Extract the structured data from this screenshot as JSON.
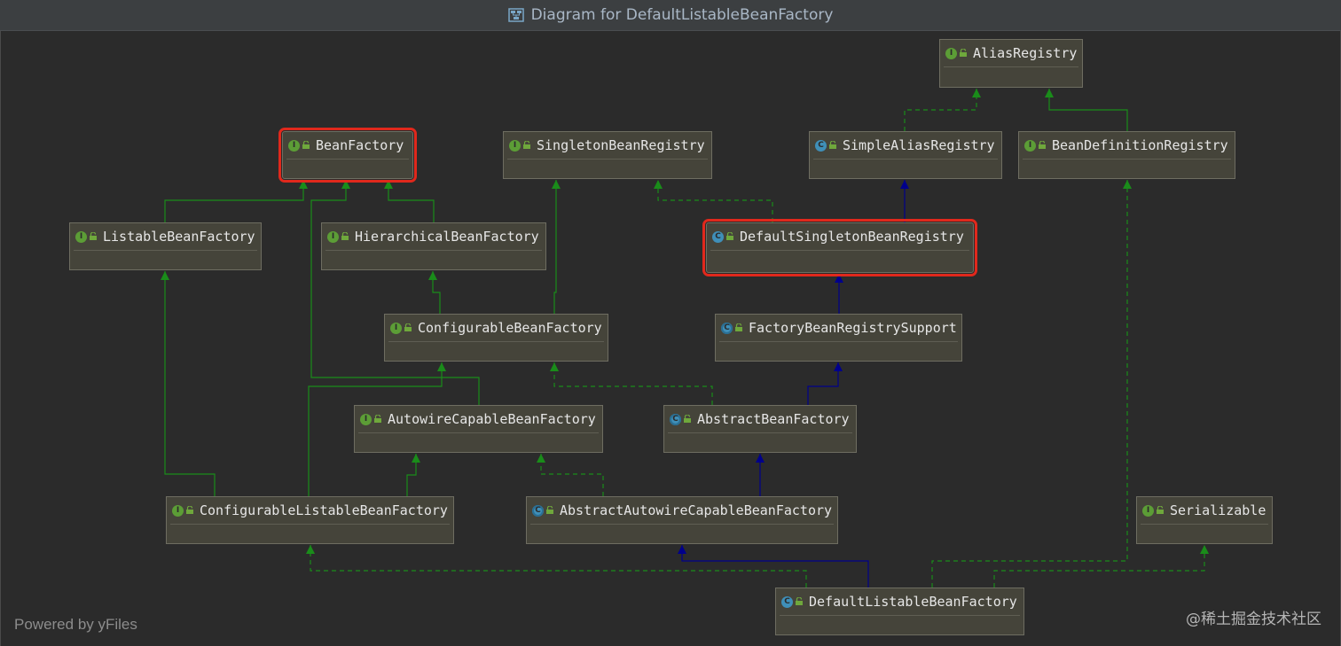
{
  "window": {
    "title": "Diagram for DefaultListableBeanFactory",
    "title_icon": "diagram-icon"
  },
  "colors": {
    "background": "#2b2b2b",
    "node_fill": "#45443a",
    "extends_edge": "#00008b",
    "implements_edge": "#1a8c1a",
    "highlight": "#e0281c",
    "interface_badge": "#5c9d36",
    "class_badge": "#3f8fb8"
  },
  "legend": {
    "interface_badge_letter": "I",
    "class_badge_letter": "C"
  },
  "nodes": [
    {
      "id": "AliasRegistry",
      "label": "AliasRegistry",
      "kind": "interface",
      "highlighted": false
    },
    {
      "id": "BeanFactory",
      "label": "BeanFactory",
      "kind": "interface",
      "highlighted": true
    },
    {
      "id": "SingletonBeanRegistry",
      "label": "SingletonBeanRegistry",
      "kind": "interface",
      "highlighted": false
    },
    {
      "id": "SimpleAliasRegistry",
      "label": "SimpleAliasRegistry",
      "kind": "class",
      "highlighted": false
    },
    {
      "id": "BeanDefinitionRegistry",
      "label": "BeanDefinitionRegistry",
      "kind": "interface",
      "highlighted": false
    },
    {
      "id": "ListableBeanFactory",
      "label": "ListableBeanFactory",
      "kind": "interface",
      "highlighted": false
    },
    {
      "id": "HierarchicalBeanFactory",
      "label": "HierarchicalBeanFactory",
      "kind": "interface",
      "highlighted": false
    },
    {
      "id": "DefaultSingletonBeanRegistry",
      "label": "DefaultSingletonBeanRegistry",
      "kind": "class",
      "highlighted": true
    },
    {
      "id": "ConfigurableBeanFactory",
      "label": "ConfigurableBeanFactory",
      "kind": "interface",
      "highlighted": false
    },
    {
      "id": "FactoryBeanRegistrySupport",
      "label": "FactoryBeanRegistrySupport",
      "kind": "abstract",
      "highlighted": false
    },
    {
      "id": "AutowireCapableBeanFactory",
      "label": "AutowireCapableBeanFactory",
      "kind": "interface",
      "highlighted": false
    },
    {
      "id": "AbstractBeanFactory",
      "label": "AbstractBeanFactory",
      "kind": "abstract",
      "highlighted": false
    },
    {
      "id": "ConfigurableListableBeanFactory",
      "label": "ConfigurableListableBeanFactory",
      "kind": "interface",
      "highlighted": false
    },
    {
      "id": "AbstractAutowireCapableBeanFactory",
      "label": "AbstractAutowireCapableBeanFactory",
      "kind": "abstract",
      "highlighted": false
    },
    {
      "id": "Serializable",
      "label": "Serializable",
      "kind": "interface",
      "highlighted": false
    },
    {
      "id": "DefaultListableBeanFactory",
      "label": "DefaultListableBeanFactory",
      "kind": "class",
      "highlighted": false
    }
  ],
  "relations": [
    {
      "from": "SimpleAliasRegistry",
      "to": "AliasRegistry",
      "type": "implements"
    },
    {
      "from": "BeanDefinitionRegistry",
      "to": "AliasRegistry",
      "type": "extends-interface"
    },
    {
      "from": "ListableBeanFactory",
      "to": "BeanFactory",
      "type": "extends-interface"
    },
    {
      "from": "HierarchicalBeanFactory",
      "to": "BeanFactory",
      "type": "extends-interface"
    },
    {
      "from": "AutowireCapableBeanFactory",
      "to": "BeanFactory",
      "type": "extends-interface"
    },
    {
      "from": "ConfigurableBeanFactory",
      "to": "HierarchicalBeanFactory",
      "type": "extends-interface"
    },
    {
      "from": "ConfigurableBeanFactory",
      "to": "SingletonBeanRegistry",
      "type": "extends-interface"
    },
    {
      "from": "DefaultSingletonBeanRegistry",
      "to": "SingletonBeanRegistry",
      "type": "implements"
    },
    {
      "from": "DefaultSingletonBeanRegistry",
      "to": "SimpleAliasRegistry",
      "type": "extends"
    },
    {
      "from": "FactoryBeanRegistrySupport",
      "to": "DefaultSingletonBeanRegistry",
      "type": "extends"
    },
    {
      "from": "AbstractBeanFactory",
      "to": "FactoryBeanRegistrySupport",
      "type": "extends"
    },
    {
      "from": "AbstractBeanFactory",
      "to": "ConfigurableBeanFactory",
      "type": "implements"
    },
    {
      "from": "ConfigurableListableBeanFactory",
      "to": "ListableBeanFactory",
      "type": "extends-interface"
    },
    {
      "from": "ConfigurableListableBeanFactory",
      "to": "ConfigurableBeanFactory",
      "type": "extends-interface"
    },
    {
      "from": "ConfigurableListableBeanFactory",
      "to": "AutowireCapableBeanFactory",
      "type": "extends-interface"
    },
    {
      "from": "AbstractAutowireCapableBeanFactory",
      "to": "AbstractBeanFactory",
      "type": "extends"
    },
    {
      "from": "AbstractAutowireCapableBeanFactory",
      "to": "AutowireCapableBeanFactory",
      "type": "implements"
    },
    {
      "from": "DefaultListableBeanFactory",
      "to": "AbstractAutowireCapableBeanFactory",
      "type": "extends"
    },
    {
      "from": "DefaultListableBeanFactory",
      "to": "ConfigurableListableBeanFactory",
      "type": "implements"
    },
    {
      "from": "DefaultListableBeanFactory",
      "to": "BeanDefinitionRegistry",
      "type": "implements"
    },
    {
      "from": "DefaultListableBeanFactory",
      "to": "Serializable",
      "type": "implements"
    }
  ],
  "footer": {
    "powered_by": "Powered by yFiles",
    "watermark": "@稀土掘金技术社区"
  }
}
